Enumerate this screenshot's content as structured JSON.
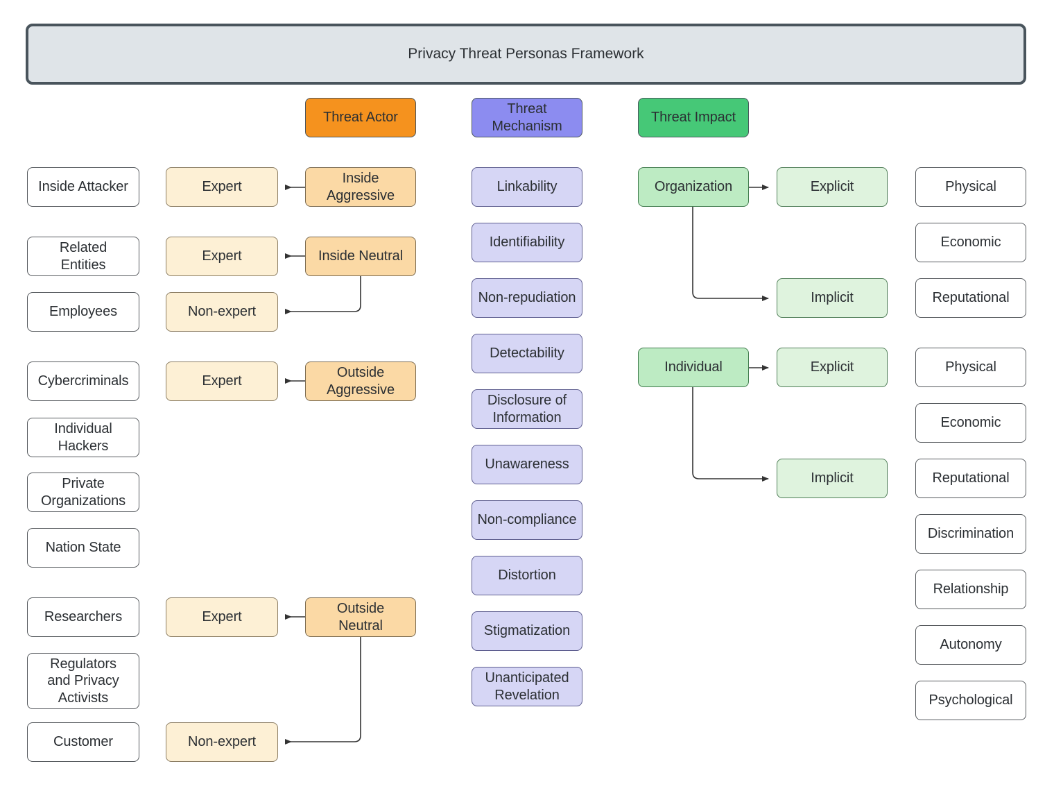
{
  "title": "Privacy Threat Personas Framework",
  "colors": {
    "banner_fill": "#dfe4e8",
    "banner_border": "#49545c",
    "actor_header": "#f5921e",
    "mechanism_header": "#8c8cf0",
    "impact_header": "#46c877",
    "actor_type_fill": "#fbd9a5",
    "expertise_fill": "#fdf0d5",
    "mechanism_fill": "#d6d6f5",
    "impact_target_fill": "#bdebc3",
    "impact_kind_fill": "#dff3de",
    "plain_fill": "#ffffff",
    "edge": "#333333",
    "text": "#2b2f33"
  },
  "headers": {
    "actor": "Threat Actor",
    "mechanism": "Threat\nMechanism",
    "impact": "Threat Impact"
  },
  "personas": [
    {
      "label": "Inside Attacker"
    },
    {
      "label": "Related\nEntities"
    },
    {
      "label": "Employees"
    },
    {
      "label": "Cybercriminals"
    },
    {
      "label": "Individual\nHackers"
    },
    {
      "label": "Private\nOrganizations"
    },
    {
      "label": "Nation State"
    },
    {
      "label": "Researchers"
    },
    {
      "label": "Regulators\nand Privacy\nActivists"
    },
    {
      "label": "Customer"
    }
  ],
  "expertise": [
    {
      "label": "Expert"
    },
    {
      "label": "Expert"
    },
    {
      "label": "Non-expert"
    },
    {
      "label": "Expert"
    },
    {
      "label": "Expert"
    },
    {
      "label": "Non-expert"
    }
  ],
  "actor_types": [
    {
      "label": "Inside\nAggressive"
    },
    {
      "label": "Inside Neutral"
    },
    {
      "label": "Outside\nAggressive"
    },
    {
      "label": "Outside\nNeutral"
    }
  ],
  "mechanisms": [
    {
      "label": "Linkability"
    },
    {
      "label": "Identifiability"
    },
    {
      "label": "Non-repudiation"
    },
    {
      "label": "Detectability"
    },
    {
      "label": "Disclosure of\nInformation"
    },
    {
      "label": "Unawareness"
    },
    {
      "label": "Non-compliance"
    },
    {
      "label": "Distortion"
    },
    {
      "label": "Stigmatization"
    },
    {
      "label": "Unanticipated\nRevelation"
    }
  ],
  "impact_targets": [
    {
      "label": "Organization"
    },
    {
      "label": "Individual"
    }
  ],
  "impact_kinds": [
    {
      "label": "Explicit"
    },
    {
      "label": "Implicit"
    },
    {
      "label": "Explicit"
    },
    {
      "label": "Implicit"
    }
  ],
  "impact_types": [
    {
      "label": "Physical"
    },
    {
      "label": "Economic"
    },
    {
      "label": "Reputational"
    },
    {
      "label": "Physical"
    },
    {
      "label": "Economic"
    },
    {
      "label": "Reputational"
    },
    {
      "label": "Discrimination"
    },
    {
      "label": "Relationship"
    },
    {
      "label": "Autonomy"
    },
    {
      "label": "Psychological"
    }
  ],
  "edges": [
    {
      "from": "Inside Aggressive",
      "to": "Expert"
    },
    {
      "from": "Inside Neutral",
      "to": "Expert"
    },
    {
      "from": "Inside Neutral",
      "to": "Non-expert"
    },
    {
      "from": "Outside Aggressive",
      "to": "Expert"
    },
    {
      "from": "Outside Neutral",
      "to": "Expert"
    },
    {
      "from": "Outside Neutral",
      "to": "Non-expert"
    },
    {
      "from": "Organization",
      "to": "Explicit"
    },
    {
      "from": "Organization",
      "to": "Implicit"
    },
    {
      "from": "Individual",
      "to": "Explicit"
    },
    {
      "from": "Individual",
      "to": "Implicit"
    }
  ]
}
